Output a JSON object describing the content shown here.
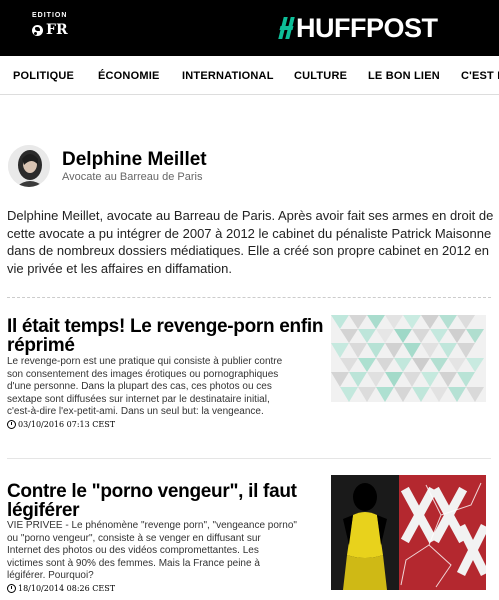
{
  "header": {
    "edition_label": "EDITION",
    "edition_value": "FR",
    "logo_text": "HUFFPOST"
  },
  "nav": {
    "items": [
      "POLITIQUE",
      "ÉCONOMIE",
      "INTERNATIONAL",
      "CULTURE",
      "LE BON LIEN",
      "C'EST LA"
    ]
  },
  "author": {
    "name": "Delphine Meillet",
    "title": "Avocate au Barreau de Paris",
    "bio_lines": [
      "Delphine Meillet, avocate au Barreau de Paris. Après avoir fait ses armes en droit de",
      "cette avocate a pu intégrer de 2007 à 2012 le cabinet du pénaliste Patrick Maisonne",
      "dans de nombreux dossiers médiatiques. Elle a créé son propre cabinet en 2012 en",
      "vie privée et les affaires en diffamation."
    ]
  },
  "articles": [
    {
      "title_lines": [
        "Il était temps! Le revenge-porn enfin",
        "réprimé"
      ],
      "excerpt_lines": [
        "Le revenge-porn est une pratique qui consiste à publier contre",
        "son consentement des images érotiques ou pornographiques",
        "d'une personne. Dans la plupart des cas, ces photos ou ces",
        "sextape sont diffusées sur internet par le destinataire initial,",
        "c'est-à-dire l'ex-petit-ami. Dans un seul but: la vengeance."
      ],
      "date": "03/10/2016 07:13 CEST"
    },
    {
      "title_lines": [
        "Contre le \"porno vengeur\", il faut",
        "légiférer"
      ],
      "excerpt_lines": [
        "VIE PRIVEE - Le phénomène \"revenge porn\", \"vengeance porno\"",
        "ou \"porno vengeur\", consiste à se venger en diffusant sur",
        "Internet des photos ou des vidéos compromettantes. Les",
        "victimes sont à 90% des femmes. Mais la France peine à",
        "légiférer. Pourquoi?"
      ],
      "date": "18/10/2014 08:26 CEST"
    }
  ],
  "colors": {
    "brand_green": "#0dbe98",
    "header_bg": "#000000"
  }
}
